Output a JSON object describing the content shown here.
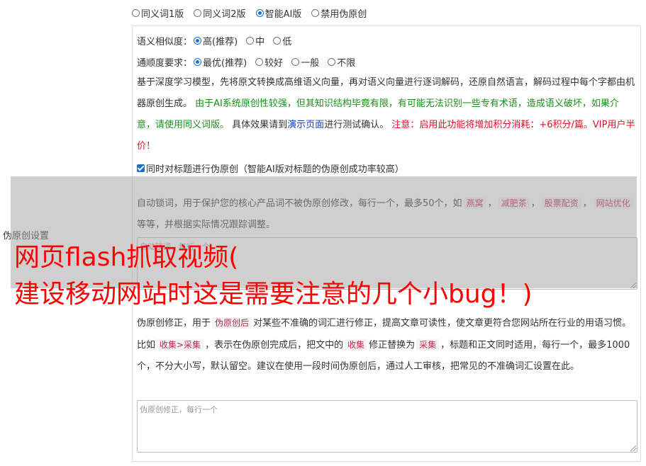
{
  "version_options": [
    {
      "label": "同义词1版",
      "checked": false
    },
    {
      "label": "同义词2版",
      "checked": false
    },
    {
      "label": "智能AI版",
      "checked": true
    },
    {
      "label": "禁用伪原创",
      "checked": false
    }
  ],
  "similarity": {
    "label": "语义相似度：",
    "options": [
      {
        "label": "高(推荐)",
        "checked": true
      },
      {
        "label": "中",
        "checked": false
      },
      {
        "label": "低",
        "checked": false
      }
    ]
  },
  "fluency": {
    "label": "通顺度要求：",
    "options": [
      {
        "label": "最优(推荐)",
        "checked": true
      },
      {
        "label": "较好",
        "checked": false
      },
      {
        "label": "一般",
        "checked": false
      },
      {
        "label": "不限",
        "checked": false
      }
    ]
  },
  "description": {
    "part1": "基于深度学习模型，先将原文转换成高维语义向量，再对语义向量进行逐词解码，还原自然语言，解码过程中每个字都由机器原创生成。",
    "part2": "由于AI系统原创性较强，但其知识结构毕竟有限，有可能无法识别一些专有术语，造成语义破坏，如果介意，请使用同义词版。",
    "part3": "具体效果请到",
    "link": "演示页面",
    "part4": "进行测试确认。",
    "part5": "注意：启用此功能将增加积分消耗：+6积分/篇。VIP用户半价！"
  },
  "title_checkbox": {
    "label": "同时对标题进行伪原创（智能AI版对标题的伪原创成功率较高）",
    "checked": true
  },
  "lock_words": {
    "text1": "自动锁词，用于保护您的核心产品词不被伪原创修改，每行一个，最多50个，如",
    "tags": [
      "燕窝",
      "减肥茶",
      "股票配资",
      "网站优化"
    ],
    "text2": "等等，并根据实际情况跟踪调整。",
    "placeholder": "自动锁词，每行一个"
  },
  "side_label": "伪原创设置",
  "correction": {
    "text1": "伪原创修正，用于",
    "tag1": "伪原创后",
    "text2": "对某些不准确的词汇进行修正，提高文章可读性，使文章更符合您网站所在行业的用语习惯。比如",
    "tag2": "收集>采集",
    "text3": "，表示在伪原创完成后，把文中的",
    "tag3": "收集",
    "text4": "修正替换为",
    "tag4": "采集",
    "text5": "，标题和正文同时适用，每行一个，最多1000个，不分大小写，默认留空。建议在使用一段时间伪原创后，通过人工审核，把常见的不准确词汇设置在此。",
    "placeholder": "伪原创修正，每行一个"
  },
  "caption": {
    "line1": "网页flash抓取视频(",
    "line2": "建设移动网站时这是需要注意的几个小bug！)"
  }
}
